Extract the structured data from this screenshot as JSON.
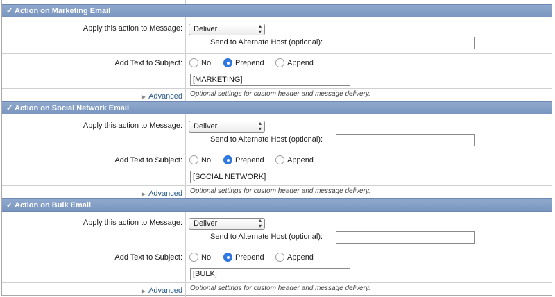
{
  "sections": [
    {
      "title": "Action on Marketing Email",
      "apply_label": "Apply this action to Message:",
      "action_value": "Deliver",
      "alt_host_label": "Send to Alternate Host (optional):",
      "alt_host_value": "",
      "subject_label": "Add Text to Subject:",
      "radio_no": "No",
      "radio_prepend": "Prepend",
      "radio_append": "Append",
      "selected_option": "Prepend",
      "subject_text": "[MARKETING]",
      "advanced_label": "Advanced",
      "advanced_note": "Optional settings for custom header and message delivery."
    },
    {
      "title": "Action on Social Network Email",
      "apply_label": "Apply this action to Message:",
      "action_value": "Deliver",
      "alt_host_label": "Send to Alternate Host (optional):",
      "alt_host_value": "",
      "subject_label": "Add Text to Subject:",
      "radio_no": "No",
      "radio_prepend": "Prepend",
      "radio_append": "Append",
      "selected_option": "Prepend",
      "subject_text": "[SOCIAL NETWORK]",
      "advanced_label": "Advanced",
      "advanced_note": "Optional settings for custom header and message delivery."
    },
    {
      "title": "Action on Bulk Email",
      "apply_label": "Apply this action to Message:",
      "action_value": "Deliver",
      "alt_host_label": "Send to Alternate Host (optional):",
      "alt_host_value": "",
      "subject_label": "Add Text to Subject:",
      "radio_no": "No",
      "radio_prepend": "Prepend",
      "radio_append": "Append",
      "selected_option": "Prepend",
      "subject_text": "[BULK]",
      "advanced_label": "Advanced",
      "advanced_note": "Optional settings for custom header and message delivery."
    }
  ],
  "colors": {
    "header_bg": "#7a96c0",
    "radio_selected": "#2f7ae5",
    "link": "#2a5b8a"
  },
  "icons": {
    "header_check": "checkmark-icon",
    "advanced_toggle": "triangle-right-icon"
  }
}
